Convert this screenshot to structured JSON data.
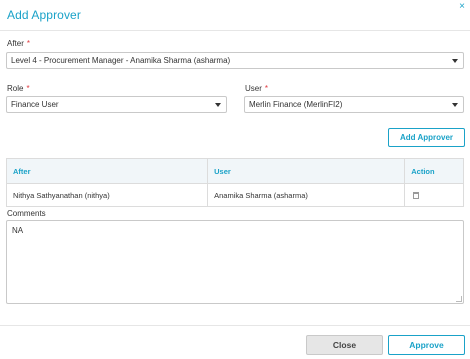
{
  "dialog": {
    "title": "Add Approver",
    "close_glyph": "×"
  },
  "form": {
    "after_label": "After",
    "after_value": "Level 4 - Procurement Manager - Anamika Sharma (asharma)",
    "role_label": "Role",
    "role_value": "Finance User",
    "user_label": "User",
    "user_value": "Merlin Finance (MerlinFI2)",
    "required_mark": "*",
    "add_approver_label": "Add Approver"
  },
  "table": {
    "columns": [
      "After",
      "User",
      "Action"
    ],
    "rows": [
      {
        "after": "Nithya Sathyanathan (nithya)",
        "user": "Anamika Sharma (asharma)",
        "action_icon": "trash-icon"
      }
    ]
  },
  "comments": {
    "label": "Comments",
    "value": "NA"
  },
  "footer": {
    "close_label": "Close",
    "approve_label": "Approve"
  },
  "colors": {
    "accent": "#1aa2c8",
    "required": "#e0383e",
    "header_bg": "#f1f6f9"
  }
}
